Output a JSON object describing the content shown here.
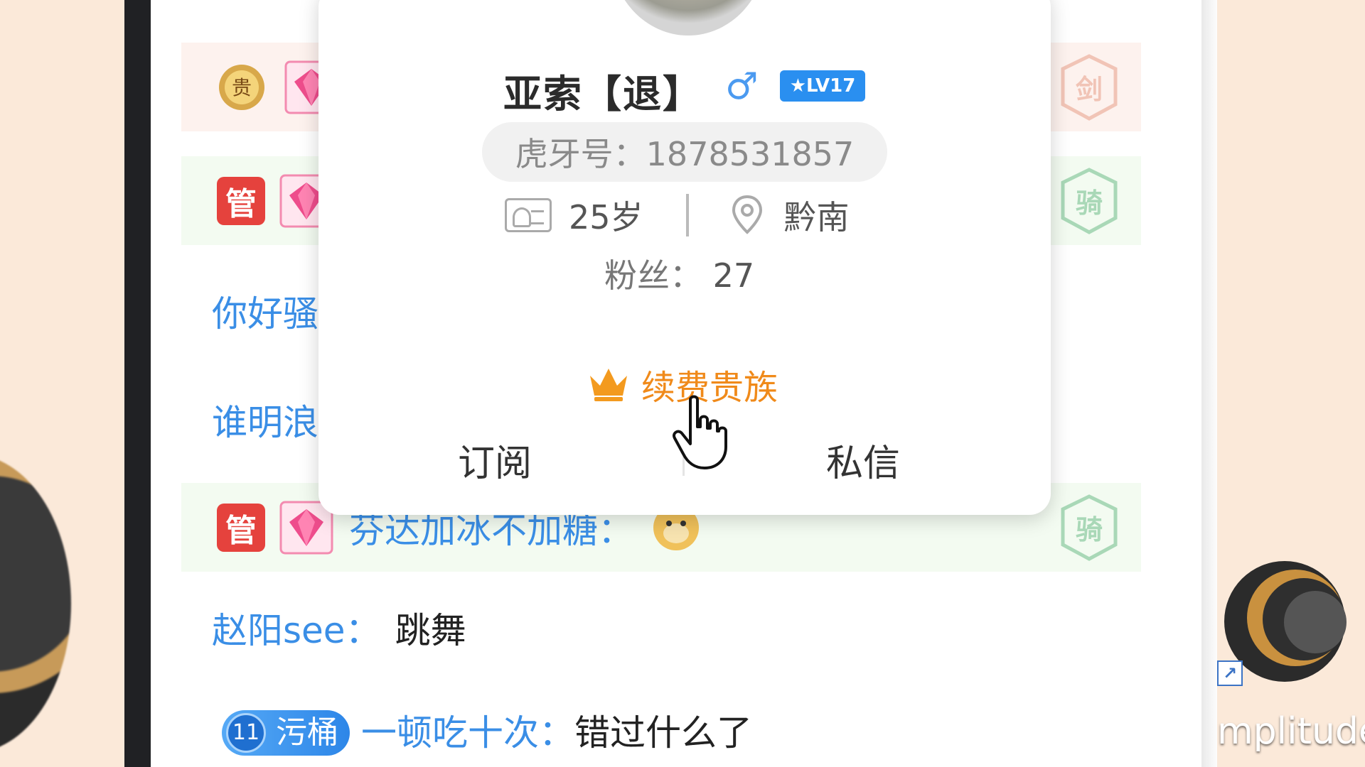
{
  "chat": {
    "rows": [
      {
        "badge": ""
      },
      {
        "badge": "管"
      },
      {
        "username": "你好骚"
      },
      {
        "username": "谁明浪"
      },
      {
        "badge": "管",
        "username": "芬达加冰不加糖：",
        "shield": "骑"
      },
      {
        "username": "赵阳see：",
        "message": "跳舞"
      },
      {
        "fan_level": "11",
        "fan_name": "污桶",
        "username": "一顿吃十次：",
        "message": "错过什么了"
      }
    ],
    "shield_top": "剑",
    "shield_second": "骑"
  },
  "popup": {
    "name": "亚索【退】",
    "gender_symbol": "♂",
    "level_badge": "★LV17",
    "huya_id": "虎牙号：1878531857",
    "age": "25岁",
    "location": "黔南",
    "fans_label": "粉丝：",
    "fans_count": "27",
    "renew_label": "续费贵族",
    "subscribe_label": "订阅",
    "message_label": "私信"
  },
  "desktop": {
    "label": "mplitude"
  },
  "colors": {
    "accent_blue": "#3a8ee6",
    "renew_orange": "#f08a1a",
    "admin_red": "#e5423d"
  }
}
